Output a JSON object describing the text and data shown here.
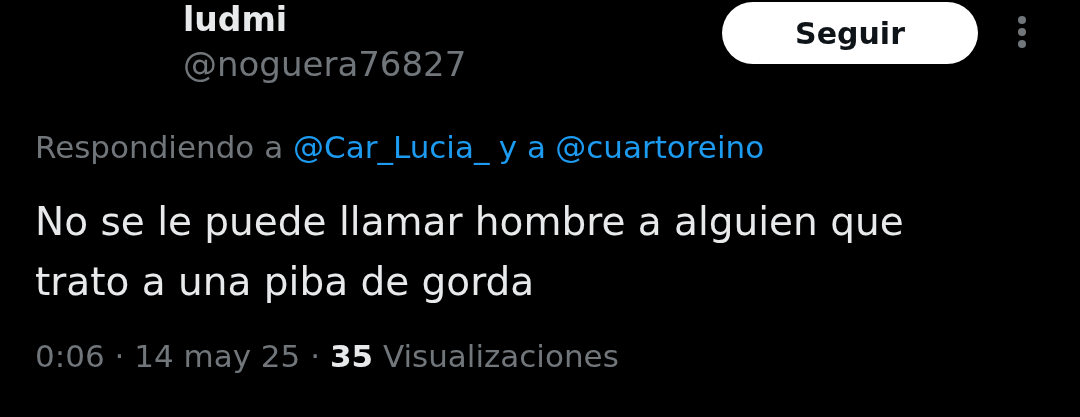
{
  "author": {
    "name": "ludmi",
    "handle": "@noguera76827"
  },
  "follow_button": "Seguir",
  "reply_context": {
    "prefix": "Respondiendo a",
    "mentions": [
      "@Car_Lucia_",
      "@cuartoreino"
    ],
    "connector": "y a"
  },
  "tweet_text": "No se le puede llamar hombre a alguien que trato a una piba de gorda",
  "meta": "0:06 · 14 may 25 · **35** Visualizaciones"
}
